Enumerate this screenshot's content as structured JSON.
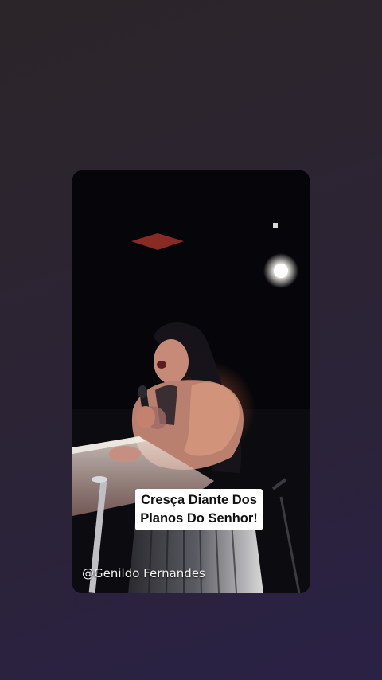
{
  "story": {
    "caption_line1": "Cresça Diante Dos",
    "caption_line2": "Planos Do Senhor!",
    "handle": "@Genildo Fernandes"
  },
  "colors": {
    "background_top": "#2b2529",
    "background_bottom": "#2a2146",
    "caption_bg": "#ffffff",
    "caption_text": "#111111",
    "handle_text": "#f2f2f2"
  }
}
